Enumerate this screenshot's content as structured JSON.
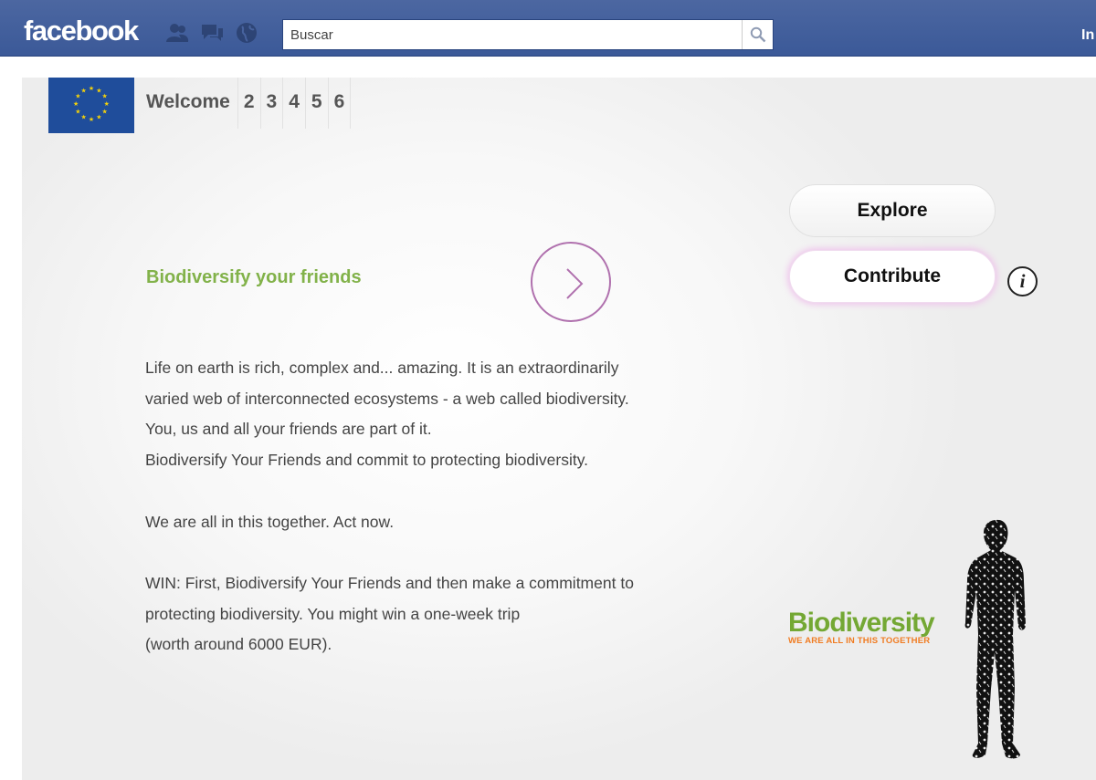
{
  "facebook": {
    "logo": "facebook",
    "search_placeholder": "Buscar",
    "top_link": "In",
    "jewels": [
      "friends-icon",
      "messages-icon",
      "notifications-globe-icon"
    ]
  },
  "app": {
    "tabs": [
      "Welcome",
      "2",
      "3",
      "4",
      "5",
      "6"
    ],
    "headline": "Biodiversify your friends",
    "body_lines": [
      "Life on earth is rich, complex and... amazing. It is an extraordinarily",
      "varied web of interconnected ecosystems - a web called biodiversity.",
      "You, us and all your friends are part of it.",
      "Biodiversify Your Friends and commit to protecting biodiversity.",
      "",
      "We are all in this together. Act now.",
      "",
      "WIN: First, Biodiversify Your Friends and then make a commitment to",
      "protecting biodiversity. You might win a one-week trip",
      "(worth around 6000 EUR)."
    ],
    "explore_label": "Explore",
    "contribute_label": "Contribute",
    "info_label": "i",
    "logo_word": "Biodiversity",
    "logo_tagline": "WE ARE ALL IN THIS TOGETHER"
  },
  "colors": {
    "facebook_blue": "#3b5998",
    "headline_green": "#82b24a",
    "arrow_purple": "#b071ae",
    "logo_green": "#74a834",
    "logo_orange": "#f07c22"
  }
}
